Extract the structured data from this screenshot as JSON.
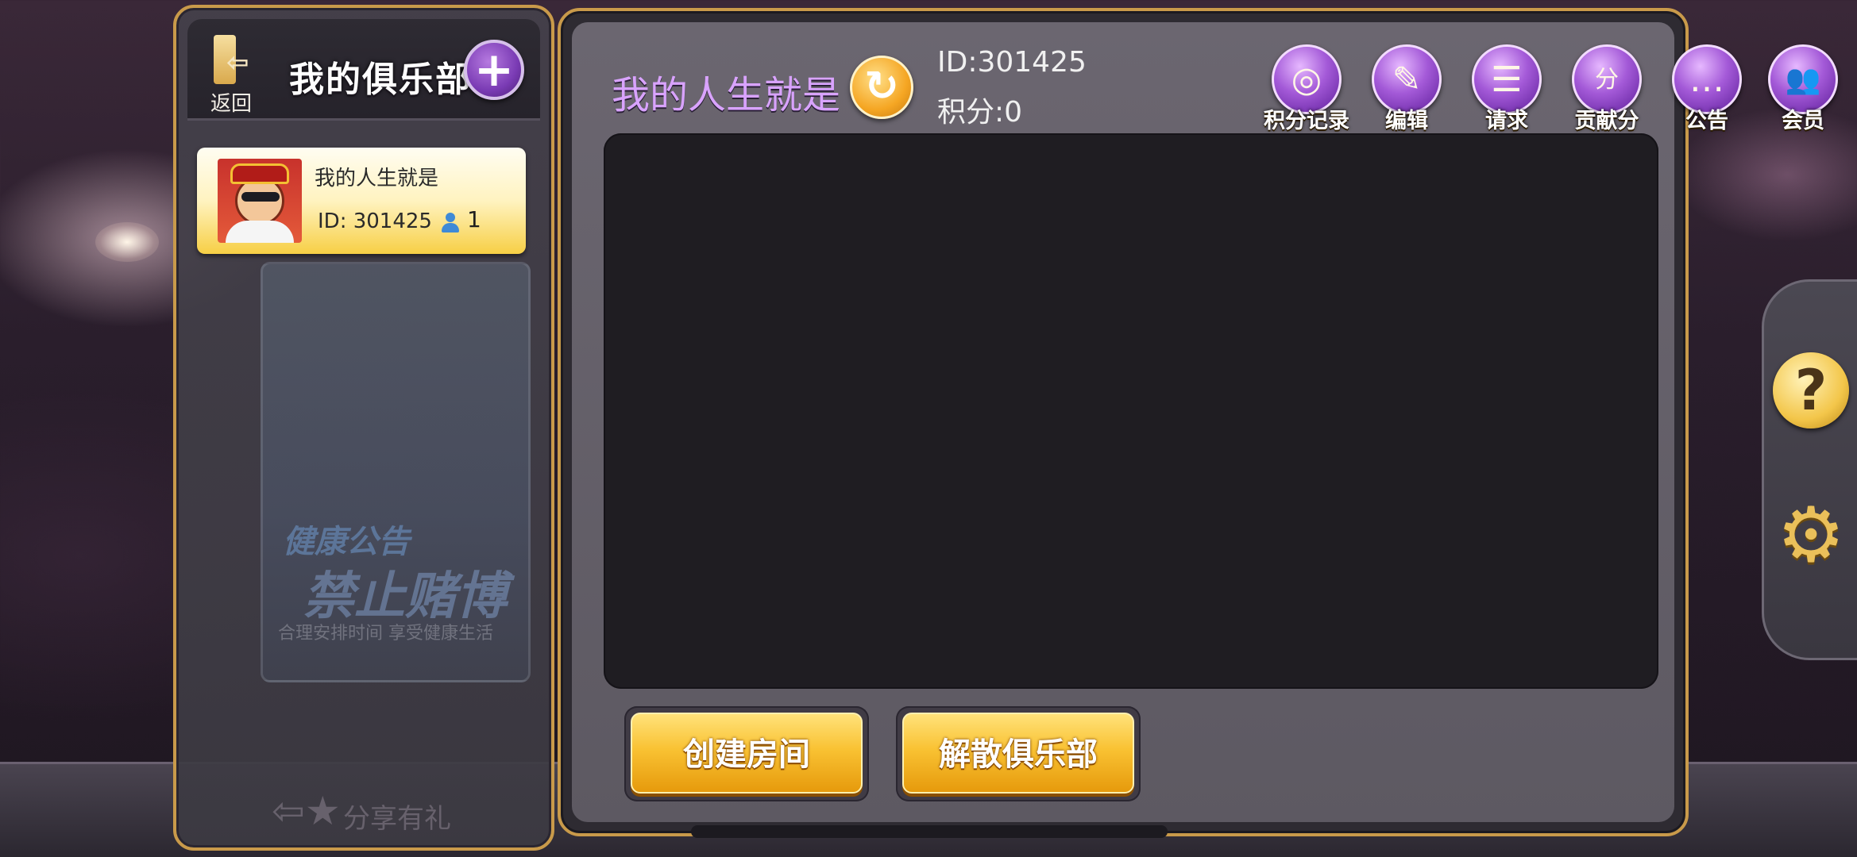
{
  "sidebar": {
    "back_label": "返回",
    "title": "我的俱乐部",
    "add_symbol": "+",
    "club": {
      "name": "我的人生就是",
      "id": "ID: 301425",
      "member_count": "1"
    },
    "poster_line1": "健康公告",
    "poster_line2": "禁止赌博",
    "poster_line3": "合理安排时间 享受健康生活",
    "share_label": "分享有礼"
  },
  "main": {
    "room_name": "我的人生就是",
    "id_text": "ID:301425",
    "score_text": "积分:0",
    "tools": [
      {
        "label": "积分记录",
        "icon": "coins-icon",
        "glyph": "◎"
      },
      {
        "label": "编辑",
        "icon": "edit-icon",
        "glyph": "✎"
      },
      {
        "label": "请求",
        "icon": "request-icon",
        "glyph": "☰"
      },
      {
        "label": "贡献分",
        "icon": "money-bag-icon",
        "glyph": "分"
      },
      {
        "label": "公告",
        "icon": "announcement-icon",
        "glyph": "…"
      },
      {
        "label": "会员",
        "icon": "members-icon",
        "glyph": "👥"
      }
    ],
    "create_room_label": "创建房间",
    "dissolve_club_label": "解散俱乐部"
  },
  "side_buttons": {
    "help_symbol": "?",
    "settings_symbol": "⚙"
  },
  "colors": {
    "panel_border": "#c99a4a",
    "room_name": "#d9a3ff",
    "button_gold": "#f9c233",
    "tool_purple": "#a45ad8"
  }
}
